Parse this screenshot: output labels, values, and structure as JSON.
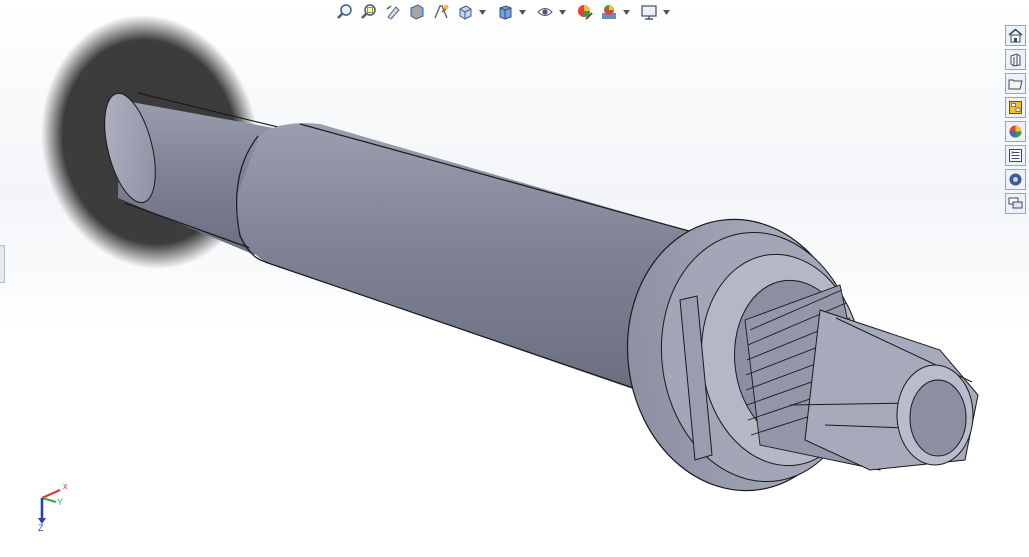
{
  "heads_up_toolbar": {
    "buttons": [
      {
        "name": "zoom-to-fit-icon"
      },
      {
        "name": "zoom-to-area-icon"
      },
      {
        "name": "previous-view-icon"
      },
      {
        "name": "section-view-icon"
      },
      {
        "name": "dynamic-annotation-icon"
      },
      {
        "name": "view-orientation-icon",
        "has_dropdown": true
      },
      {
        "name": "display-style-icon",
        "has_dropdown": true
      },
      {
        "name": "hide-show-items-icon",
        "has_dropdown": true
      },
      {
        "name": "edit-appearance-icon"
      },
      {
        "name": "apply-scene-icon",
        "has_dropdown": true
      },
      {
        "name": "view-settings-icon",
        "has_dropdown": true
      }
    ]
  },
  "task_pane": {
    "tabs": [
      {
        "name": "solidworks-resources-icon"
      },
      {
        "name": "design-library-icon"
      },
      {
        "name": "file-explorer-icon"
      },
      {
        "name": "view-palette-icon"
      },
      {
        "name": "appearances-scenes-icon"
      },
      {
        "name": "custom-properties-icon"
      },
      {
        "name": "solidworks-forum-icon"
      },
      {
        "name": "feedback-icon"
      }
    ]
  },
  "reference_triad": {
    "x_label": "x",
    "y_label": "Y",
    "z_label": "Z",
    "colors": {
      "x": "#d93a3a",
      "y": "#3aa84a",
      "z": "#2a3fb8"
    }
  },
  "model": {
    "body_color": "#7d8192",
    "edge_color": "#1a1a1a"
  }
}
